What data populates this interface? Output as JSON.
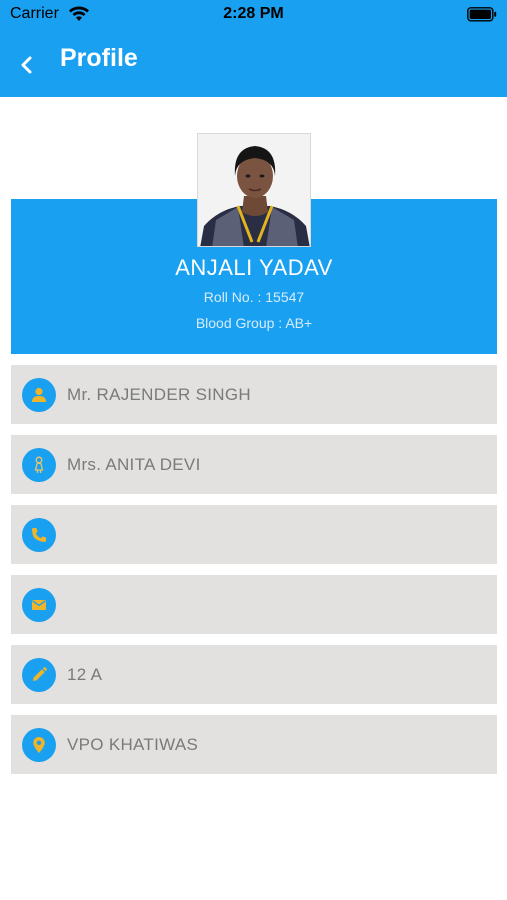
{
  "status_bar": {
    "carrier": "Carrier",
    "time": "2:28 PM"
  },
  "app_bar": {
    "title": "Profile",
    "back_icon": "chevron-left-icon",
    "color": "#1aa0f0"
  },
  "profile": {
    "name": "ANJALI YADAV",
    "roll_no": "Roll No. : 15547",
    "blood_group": "Blood Group : AB+"
  },
  "info_rows": [
    {
      "icon": "person-icon",
      "text": "Mr. RAJENDER SINGH"
    },
    {
      "icon": "woman-icon",
      "text": "Mrs. ANITA DEVI"
    },
    {
      "icon": "phone-icon",
      "text": ""
    },
    {
      "icon": "email-icon",
      "text": ""
    },
    {
      "icon": "pencil-icon",
      "text": "12 A"
    },
    {
      "icon": "location-icon",
      "text": "VPO KHATIWAS"
    }
  ],
  "colors": {
    "accent": "#1aa0f0",
    "icon_glyph": "#f0b428",
    "row_background": "#e2e1df"
  }
}
